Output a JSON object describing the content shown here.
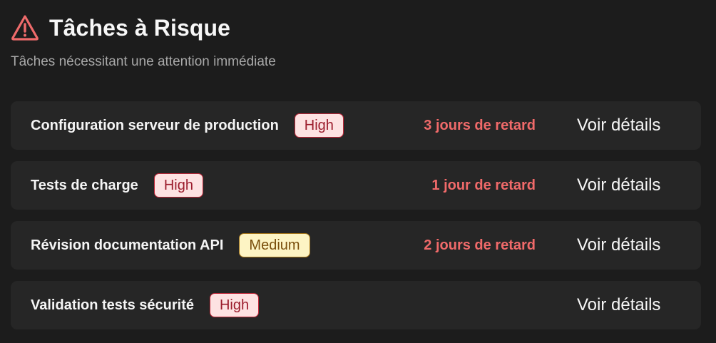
{
  "header": {
    "icon": "warning-triangle-icon",
    "title": "Tâches à Risque",
    "subtitle": "Tâches nécessitant une attention immédiate"
  },
  "colors": {
    "background": "#1c1c1c",
    "card": "#262626",
    "danger": "#f06a6a",
    "high_badge_bg": "#fde2e2",
    "high_badge_text": "#9b1c2c",
    "medium_badge_bg": "#fdf4c4",
    "medium_badge_text": "#7a4f0c"
  },
  "tasks": [
    {
      "name": "Configuration serveur de production",
      "priority": "High",
      "delay": "3 jours de retard",
      "action": "Voir détails"
    },
    {
      "name": "Tests de charge",
      "priority": "High",
      "delay": "1 jour de retard",
      "action": "Voir détails"
    },
    {
      "name": "Révision documentation API",
      "priority": "Medium",
      "delay": "2 jours de retard",
      "action": "Voir détails"
    },
    {
      "name": "Validation tests sécurité",
      "priority": "High",
      "delay": "",
      "action": "Voir détails"
    }
  ]
}
